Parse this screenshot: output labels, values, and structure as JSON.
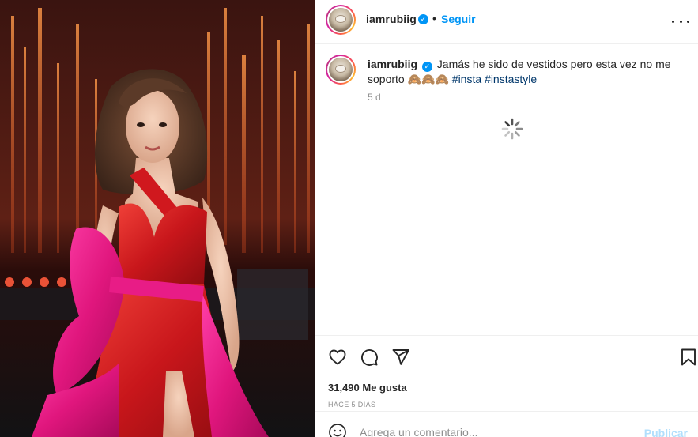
{
  "post": {
    "username": "iamrubiig",
    "separator": "•",
    "follow_label": "Seguir",
    "caption_text": "Jamás he sido de vestidos pero esta vez no me soporto 🙈🙈🙈",
    "hashtags": [
      "#insta",
      "#instastyle"
    ],
    "age": "5 d",
    "likes": "31,490 Me gusta",
    "posted_ago": "HACE 5 DÍAS"
  },
  "comment": {
    "placeholder": "Agrega un comentario...",
    "publish_label": "Publicar"
  },
  "colors": {
    "accent": "#0095f6",
    "hashtag": "#00376b",
    "muted": "#8e8e8e",
    "publish_disabled": "#b2dffc"
  },
  "icons": [
    "verified-badge-icon",
    "more-options-icon",
    "heart-icon",
    "comment-icon",
    "share-icon",
    "bookmark-icon",
    "emoji-icon",
    "loading-spinner-icon"
  ]
}
